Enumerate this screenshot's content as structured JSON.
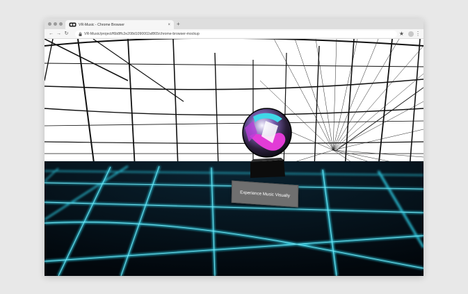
{
  "browser": {
    "tab_title": "VR-Music - Chrome Browser",
    "tab_close": "×",
    "new_tab": "+",
    "url": "VR-Music/project/f6b8ffc2e208d1090002af865/chrome-browser-mockup",
    "back": "←",
    "forward": "→",
    "reload": "↻",
    "star": "★",
    "menu": "⋮"
  },
  "scene": {
    "caption": "Experience Music Visually"
  }
}
